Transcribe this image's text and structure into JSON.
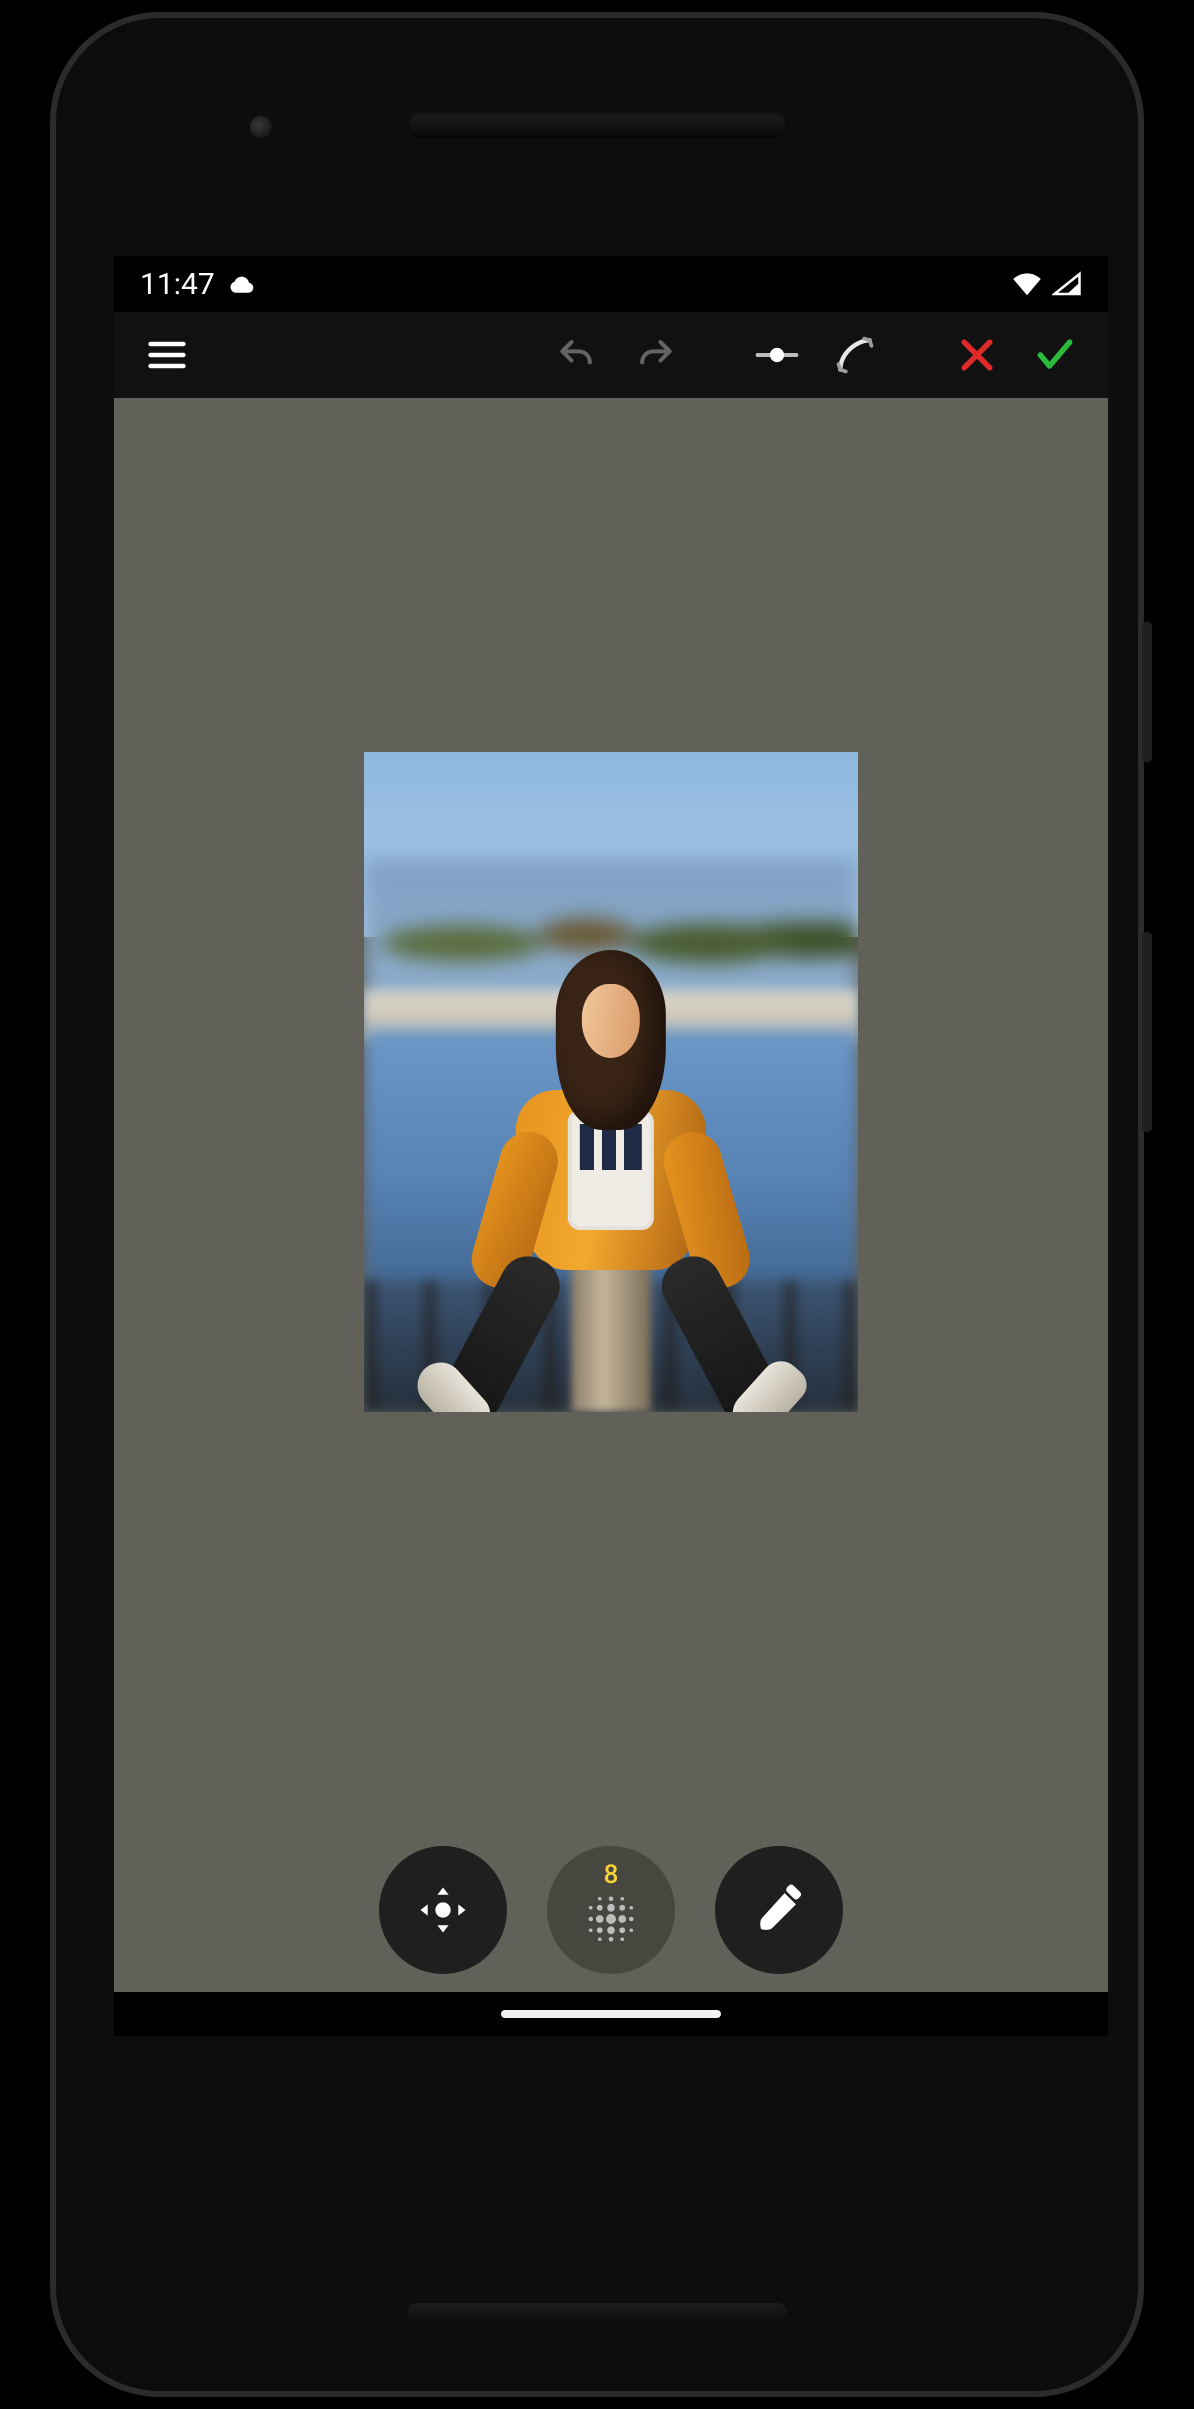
{
  "status": {
    "time": "11:47"
  },
  "icons": {
    "menu": "menu-icon",
    "undo": "undo-icon",
    "redo": "redo-icon",
    "compare": "compare-slider-icon",
    "curve": "curve-arrows-icon",
    "cancel": "close-icon",
    "accept": "check-icon",
    "move": "move-icon",
    "blur": "blur-grid-icon",
    "brush": "brush-icon",
    "cloud": "cloud-icon",
    "wifi": "wifi-icon",
    "cell": "cell-signal-icon"
  },
  "toolbar": {
    "undo_enabled": false,
    "redo_enabled": false
  },
  "editor": {
    "blur_strength": "8",
    "tools": [
      "move",
      "blur",
      "brush"
    ],
    "active_tool": "blur"
  },
  "colors": {
    "canvas_bg": "#616059",
    "accent_yellow": "#f5d23a",
    "accept_green": "#2bbb3a",
    "cancel_red": "#e02a2a"
  }
}
